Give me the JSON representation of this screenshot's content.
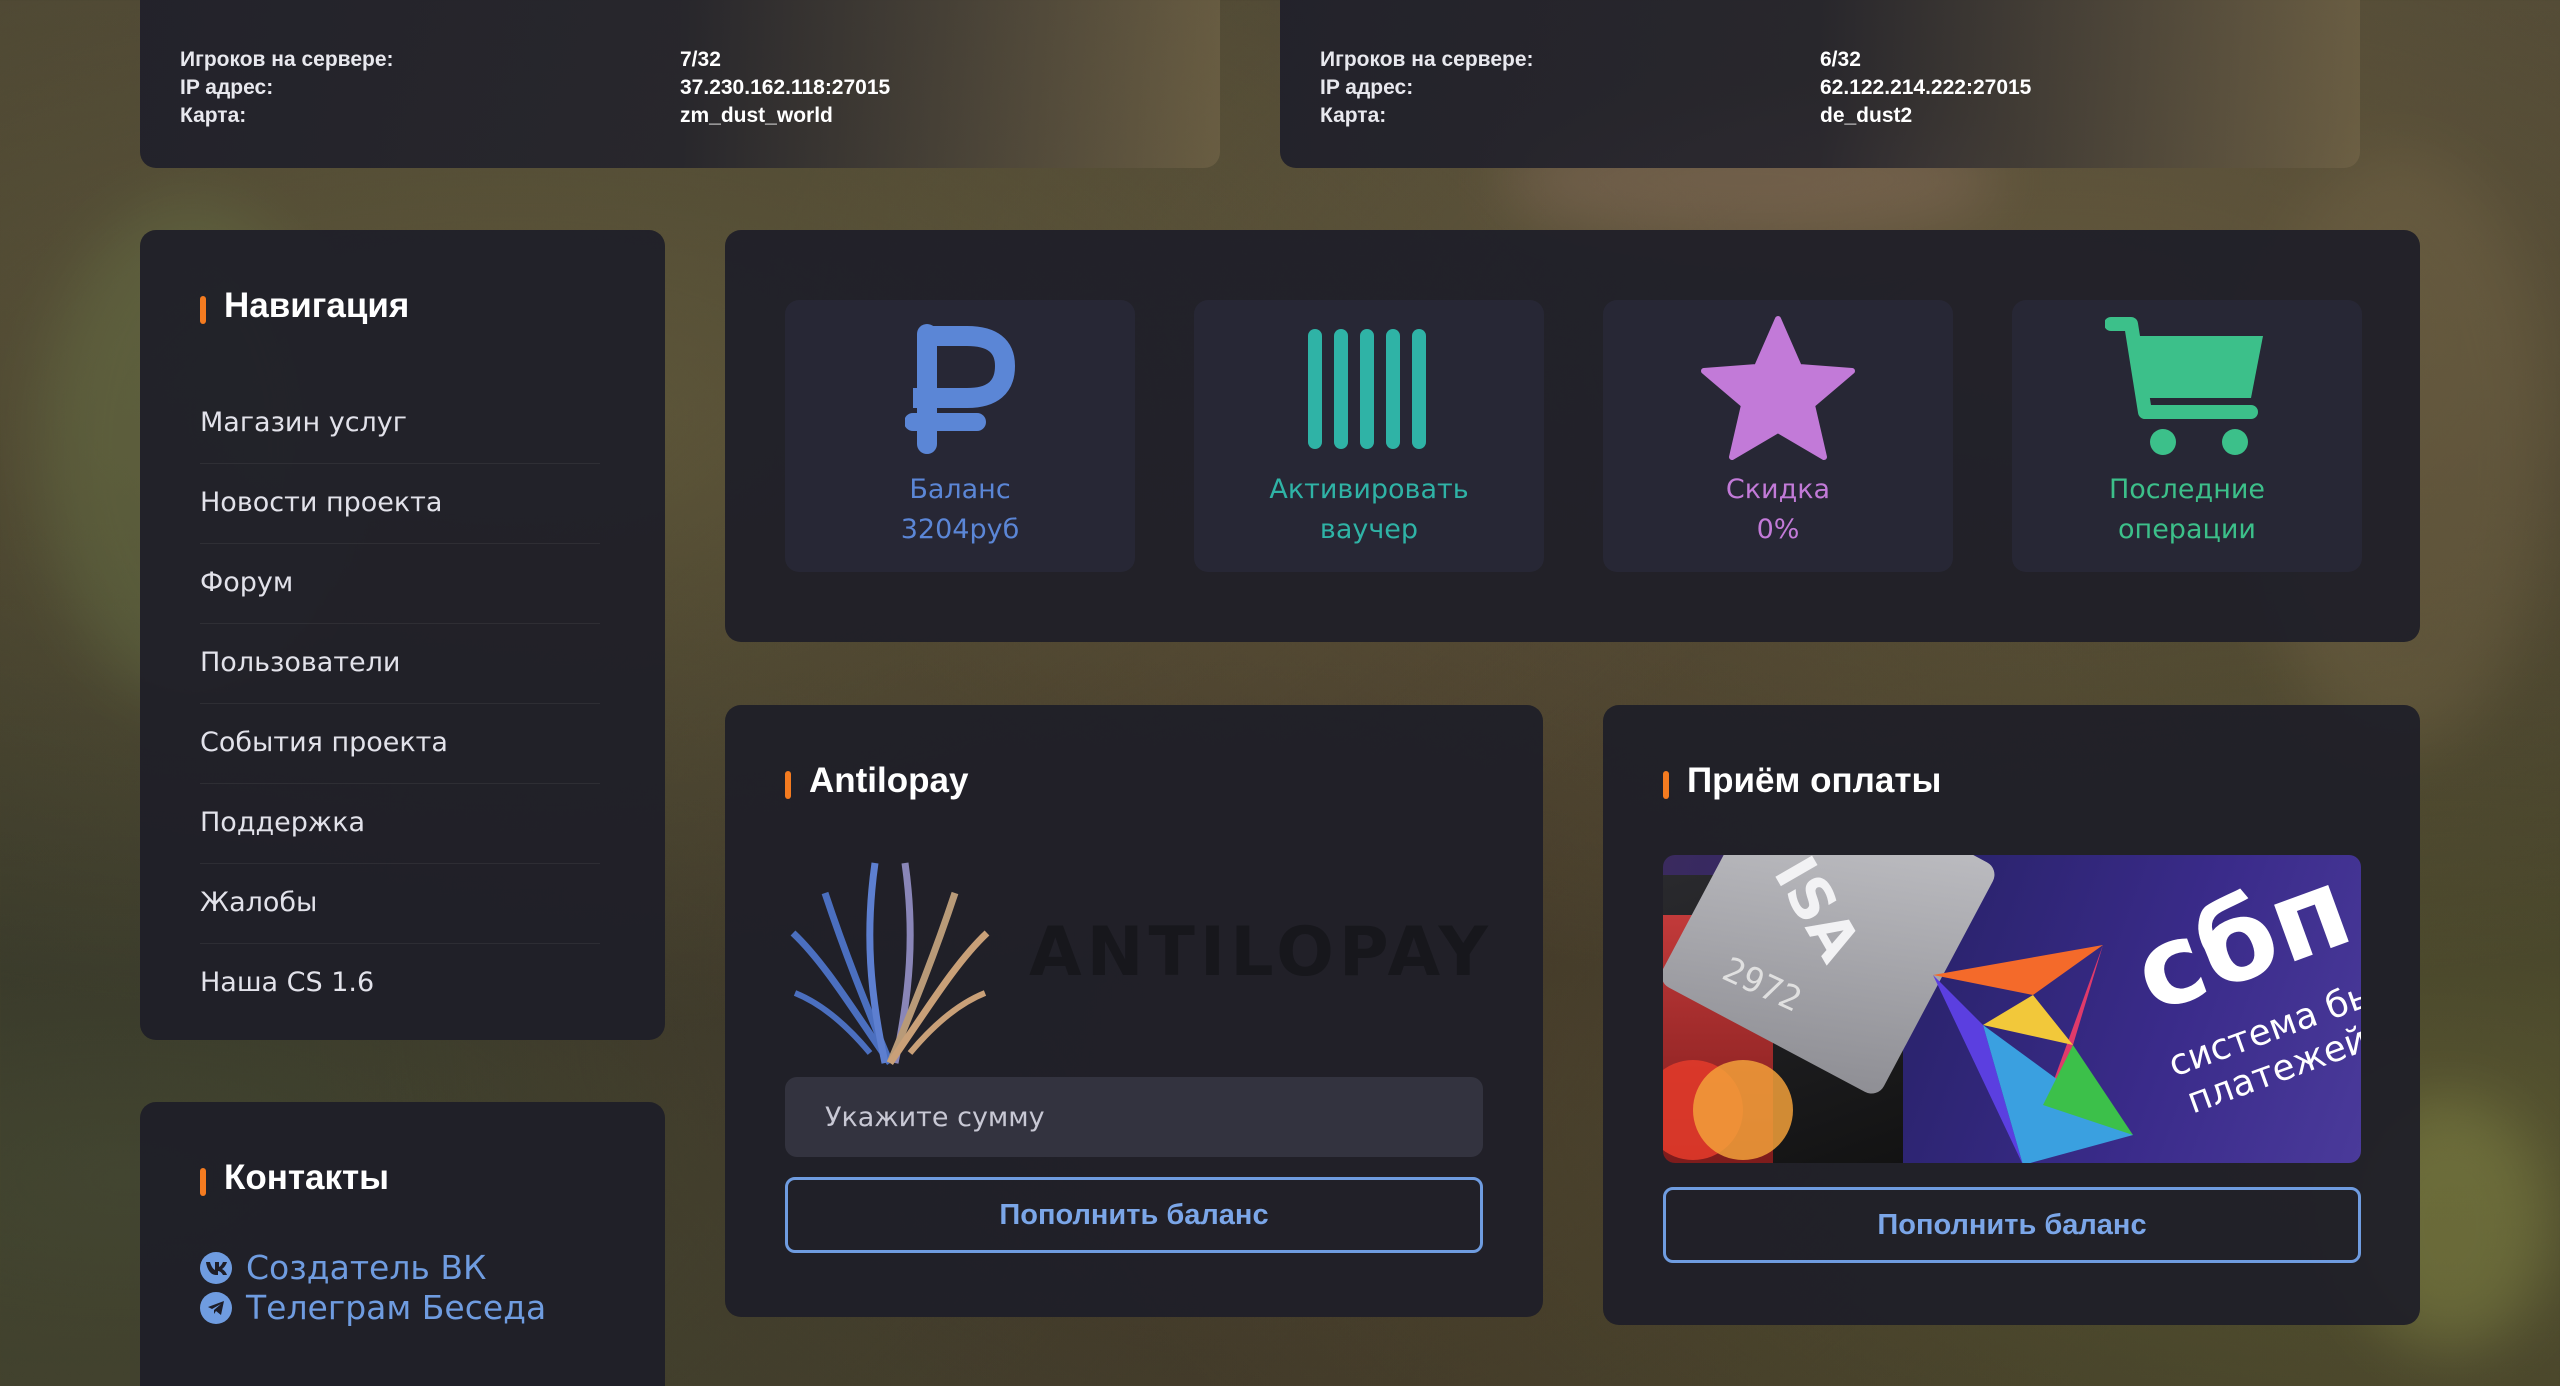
{
  "servers": [
    {
      "players_label": "Игроков на сервере:",
      "ip_label": "IP адрес:",
      "map_label": "Карта:",
      "players": "7/32",
      "ip": "37.230.162.118:27015",
      "map": "zm_dust_world"
    },
    {
      "players_label": "Игроков на сервере:",
      "ip_label": "IP адрес:",
      "map_label": "Карта:",
      "players": "6/32",
      "ip": "62.122.214.222:27015",
      "map": "de_dust2"
    }
  ],
  "navigation": {
    "title": "Навигация",
    "items": [
      "Магазин услуг",
      "Новости проекта",
      "Форум",
      "Пользователи",
      "События проекта",
      "Поддержка",
      "Жалобы",
      "Наша CS 1.6"
    ]
  },
  "contacts": {
    "title": "Контакты",
    "links": [
      {
        "label": "Создатель ВК",
        "icon": "vk-icon"
      },
      {
        "label": "Телеграм Беседа",
        "icon": "telegram-icon"
      }
    ]
  },
  "stats": [
    {
      "icon": "ruble-icon",
      "line1": "Баланс",
      "line2": "3204руб",
      "color": "#5b86d6"
    },
    {
      "icon": "barcode-icon",
      "line1": "Активировать",
      "line2": "ваучер",
      "color": "#2fb3a6"
    },
    {
      "icon": "star-icon",
      "line1": "Скидка",
      "line2": "0%",
      "color": "#c27ad8"
    },
    {
      "icon": "cart-icon",
      "line1": "Последние",
      "line2": "операции",
      "color": "#3cc08a"
    }
  ],
  "antilopay": {
    "title": "Antilopay",
    "logo_text": "ANTILOPAY",
    "amount_placeholder": "Укажите сумму",
    "button_label": "Пополнить баланс"
  },
  "payment": {
    "title": "Приём оплаты",
    "banner_logo": "сбп",
    "banner_tagline_1": "система быс",
    "banner_tagline_2": "платежей",
    "card_text_1": "ISA",
    "card_text_2": "2972",
    "button_label": "Пополнить баланс"
  },
  "colors": {
    "accent": "#f47b20",
    "link": "#6f9ce0",
    "panel": "#1e1e28"
  }
}
